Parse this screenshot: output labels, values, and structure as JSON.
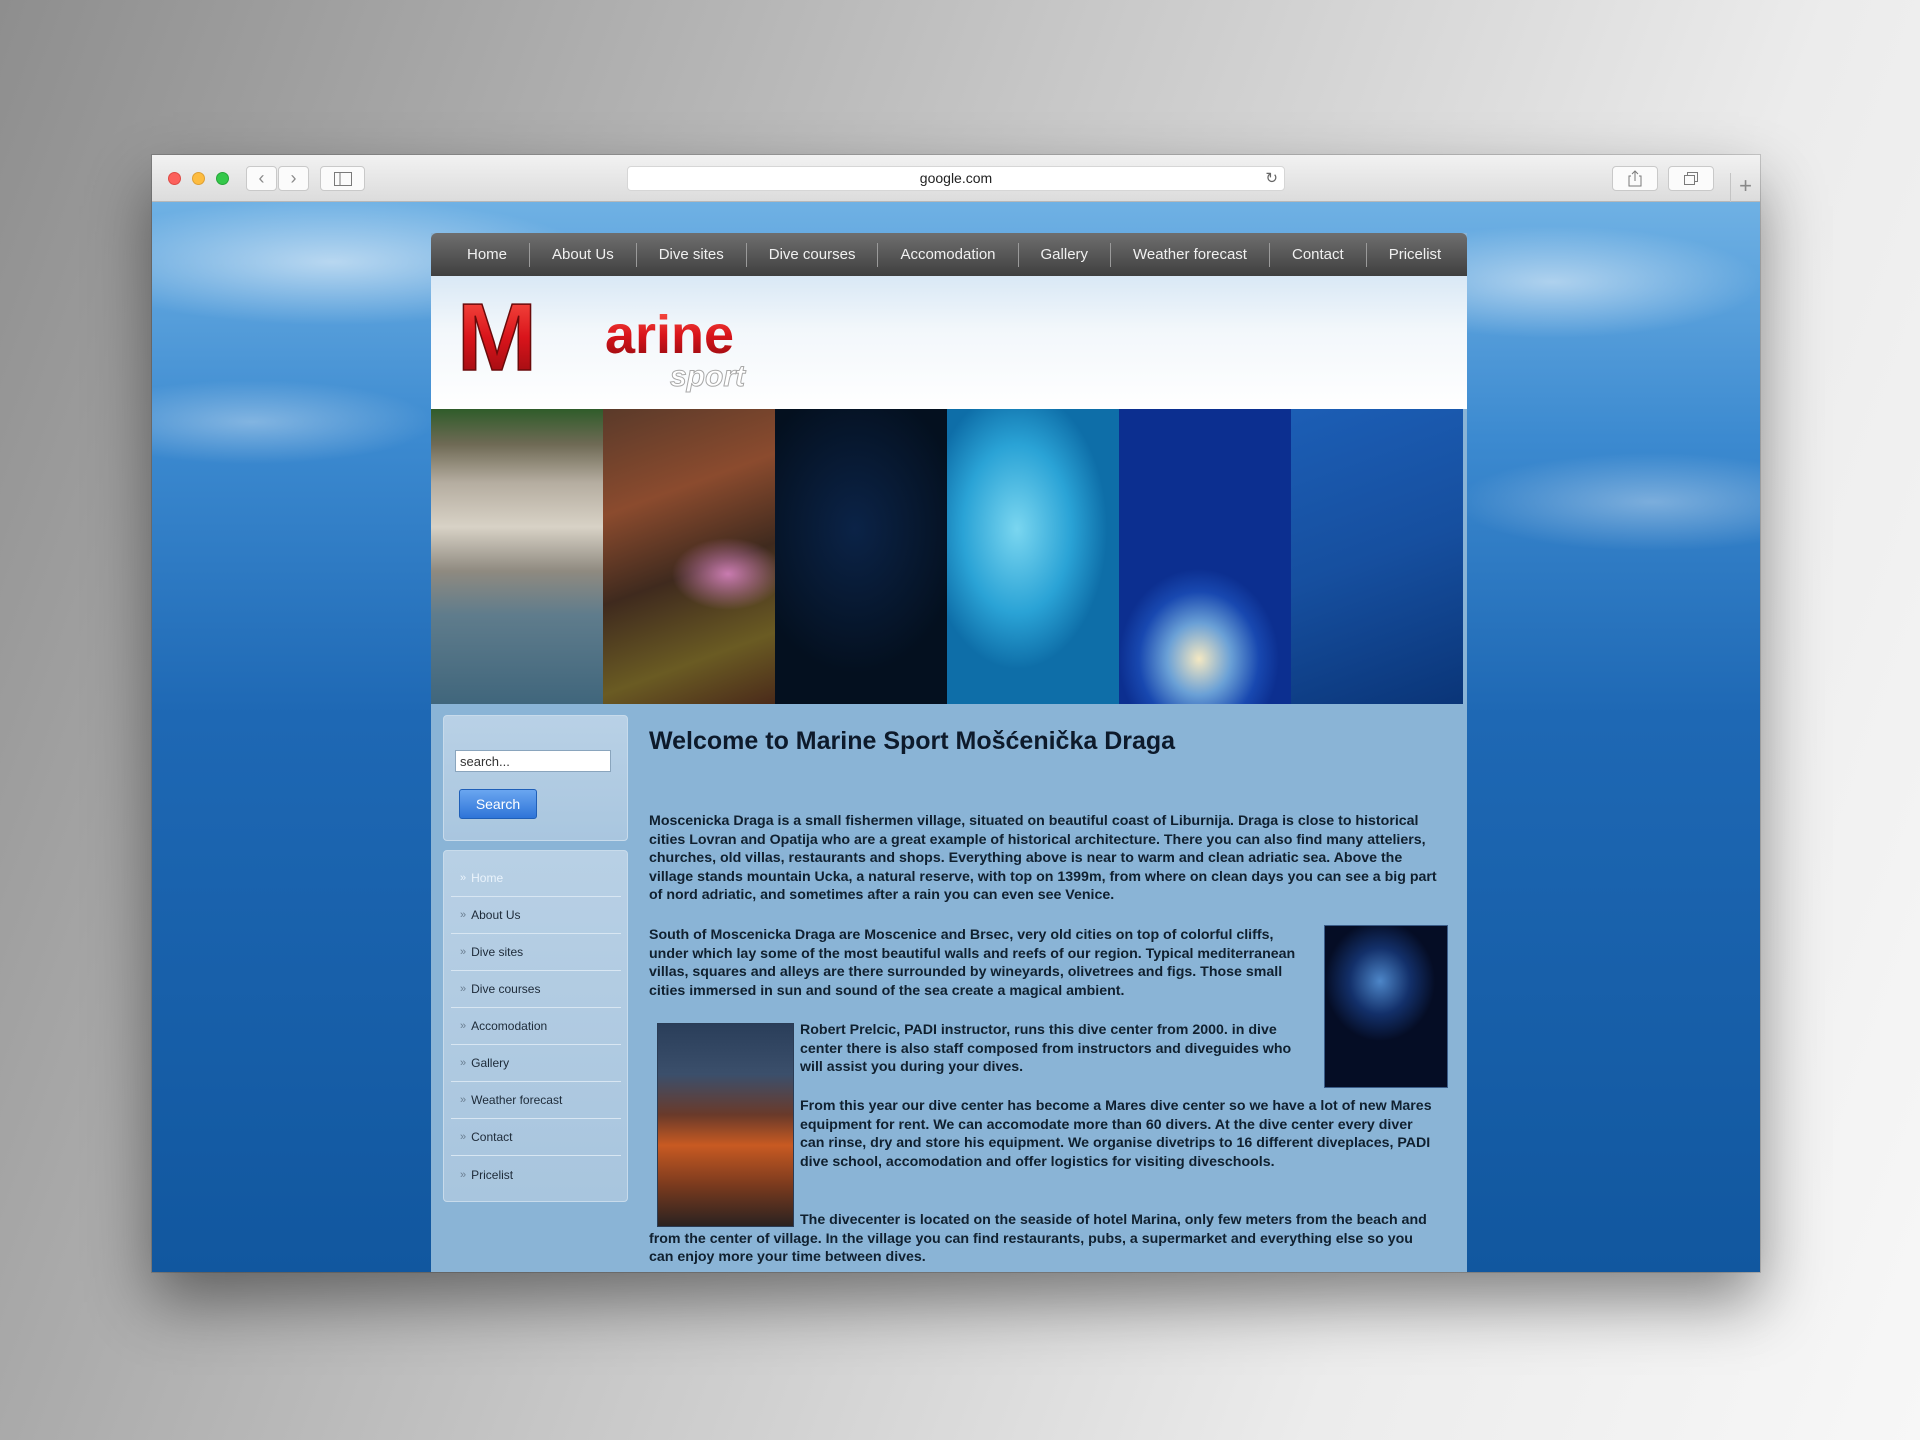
{
  "browser": {
    "url": "google.com",
    "reload_icon": "reload-icon",
    "back_icon": "chevron-left-icon",
    "forward_icon": "chevron-right-icon"
  },
  "site": {
    "nav": [
      "Home",
      "About Us",
      "Dive sites",
      "Dive courses",
      "Accomodation",
      "Gallery",
      "Weather forecast",
      "Contact",
      "Pricelist"
    ],
    "logo": {
      "big_letter": "M",
      "word": "arine",
      "sub": "sport"
    },
    "search": {
      "placeholder": "search...",
      "button": "Search"
    },
    "side_menu": [
      "Home",
      "About Us",
      "Dive sites",
      "Dive courses",
      "Accomodation",
      "Gallery",
      "Weather forecast",
      "Contact",
      "Pricelist"
    ],
    "title": "Welcome to Marine Sport Mošćenička Draga",
    "paragraphs": [
      "Moscenicka Draga is a small fishermen village, situated on beautiful coast of Liburnija. Draga is close to historical cities Lovran and Opatija who are a great example of historical architecture. There you can also find many atteliers, churches, old villas, restaurants and shops. Everything above is near to warm and clean adriatic sea. Above the village stands mountain Ucka, a natural reserve, with top on 1399m, from where on clean days you can see a big part of nord adriatic, and sometimes after a rain you can even see Venice.",
      "South of Moscenicka Draga are Moscenice and Brsec, very old cities on top of colorful cliffs, under which lay some of the most beautiful walls and reefs of our region. Typical mediterranean villas, squares and alleys are there surrounded by wineyards, olivetrees and figs. Those small cities immersed in sun and sound of the sea create a magical ambient.",
      "Robert Prelcic, PADI instructor, runs this dive center from 2000. in dive center there is also staff composed from instructors and diveguides who will assist you during your dives.",
      "From this year our dive center has become a Mares dive center so we have a lot of new Mares equipment for rent. We can accomodate more than 60 divers. At the dive center every diver can rinse, dry and store his equipment. We organise divetrips to 16 different diveplaces, PADI dive school, accomodation and offer logistics for visiting diveschools.",
      "The divecenter is located on the seaside of hotel Marina, only few meters from the beach and from the center of village. In the village you can find restaurants, pubs, a supermarket and everything else so you can enjoy more your time between dives."
    ]
  },
  "colors": {
    "logo_red": "#d9141b",
    "nav_bg": "#4f4f4f",
    "content_bg": "#8ab4d6"
  }
}
